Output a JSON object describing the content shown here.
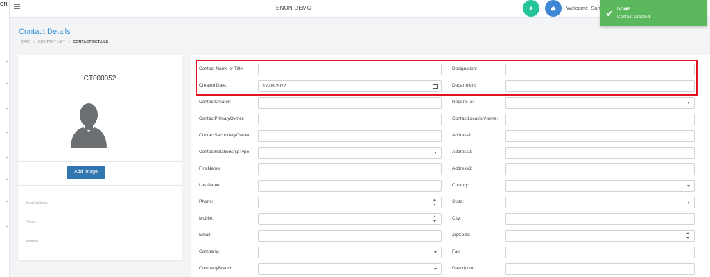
{
  "app": {
    "logo_text": "ON",
    "title": "ENON DEMO",
    "welcome": "Welcome, Sand"
  },
  "nav": {
    "back_icon": "arrow-left-icon",
    "home_icon": "home-icon",
    "menu_icon": "hamburger-icon"
  },
  "toast": {
    "title": "DONE",
    "message": "Contact Created",
    "color": "#5cb85c",
    "icon": "check-icon"
  },
  "header": {
    "title": "Contact Details",
    "breadcrumb": [
      {
        "label": "HOME"
      },
      {
        "label": "CONTACT LIST"
      },
      {
        "label": "CONTACT DETAILS"
      }
    ]
  },
  "profile": {
    "contact_id": "CT000052",
    "add_image_label": "Add Image",
    "email_label": "Email address",
    "phone_label": "Phone",
    "address_label": "Address",
    "address_value": "- -"
  },
  "form": {
    "left": [
      {
        "label": "Contact Name or Title:",
        "value": "",
        "kind": "text"
      },
      {
        "label": "Created Date:",
        "value": "17-08-2022",
        "kind": "date"
      },
      {
        "label": "ContactCreator:",
        "value": "",
        "kind": "text"
      },
      {
        "label": "ContactPrimaryOwner:",
        "value": "",
        "kind": "text"
      },
      {
        "label": "ContactSecondaryOwner:",
        "value": "",
        "kind": "text"
      },
      {
        "label": "ContactRelationshipType:",
        "value": "",
        "kind": "select"
      },
      {
        "label": "FirstName:",
        "value": "",
        "kind": "text"
      },
      {
        "label": "LastName:",
        "value": "",
        "kind": "text"
      },
      {
        "label": "Phone:",
        "value": "",
        "kind": "number"
      },
      {
        "label": "Mobile:",
        "value": "",
        "kind": "number"
      },
      {
        "label": "Email:",
        "value": "",
        "kind": "text"
      },
      {
        "label": "Company:",
        "value": "",
        "kind": "select"
      },
      {
        "label": "CompanyBranch:",
        "value": "",
        "kind": "select"
      }
    ],
    "right": [
      {
        "label": "Designation:",
        "value": "",
        "kind": "text"
      },
      {
        "label": "Department:",
        "value": "",
        "kind": "text"
      },
      {
        "label": "ReportsTo:",
        "value": "",
        "kind": "select"
      },
      {
        "label": "ContactLocationName:",
        "value": "",
        "kind": "text"
      },
      {
        "label": "Address1:",
        "value": "",
        "kind": "text"
      },
      {
        "label": "Address2:",
        "value": "",
        "kind": "text"
      },
      {
        "label": "Address3:",
        "value": "",
        "kind": "text"
      },
      {
        "label": "Country:",
        "value": "",
        "kind": "select"
      },
      {
        "label": "State:",
        "value": "",
        "kind": "select"
      },
      {
        "label": "City:",
        "value": "",
        "kind": "text"
      },
      {
        "label": "ZipCode:",
        "value": "",
        "kind": "number"
      },
      {
        "label": "Fax:",
        "value": "",
        "kind": "text"
      },
      {
        "label": "Description:",
        "value": "",
        "kind": "text"
      }
    ]
  },
  "colors": {
    "accent": "#3a93d6",
    "highlight_border": "#e0141e",
    "back_button": "#26c49a",
    "home_button": "#3f86d4",
    "add_image_button": "#3276b1"
  }
}
